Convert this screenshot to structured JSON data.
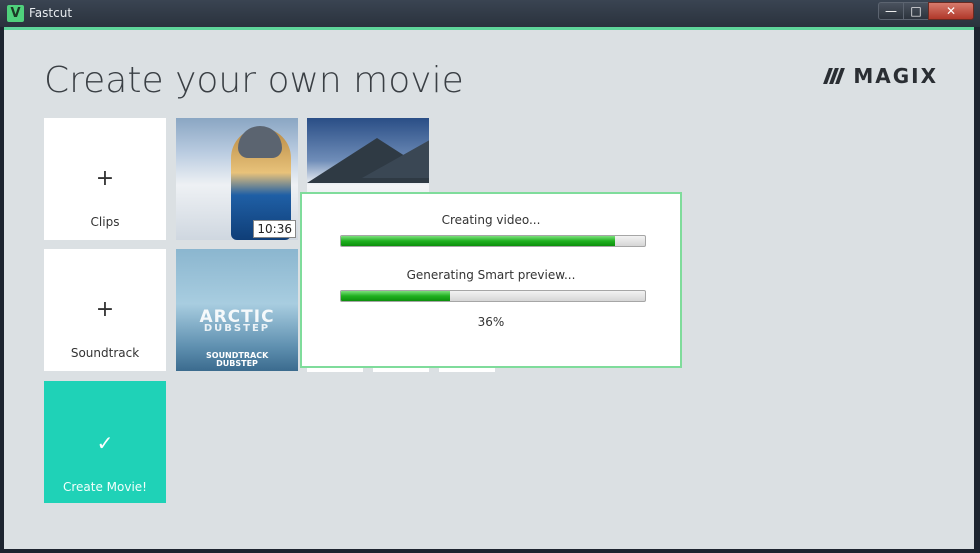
{
  "window": {
    "app_name": "Fastcut",
    "app_icon_letter": "V",
    "controls": {
      "minimize": "—",
      "maximize": "□",
      "close": "✕"
    }
  },
  "header": {
    "title": "Create your own movie",
    "brand": "MAGIX"
  },
  "tiles": {
    "clips": {
      "icon": "+",
      "label": "Clips"
    },
    "soundtrack": {
      "icon": "+",
      "label": "Soundtrack"
    },
    "create": {
      "icon": "✓",
      "label": "Create Movie!"
    }
  },
  "media": {
    "clip1_duration": "10:36",
    "soundtrack_title": "ARCTIC",
    "soundtrack_subtitle": "DUBSTEP",
    "soundtrack_badge_line1": "SOUNDTRACK",
    "soundtrack_badge_line2": "DUBSTEP"
  },
  "progress_dialog": {
    "task1_label": "Creating video...",
    "task1_progress": 0.9,
    "task2_label": "Generating Smart preview...",
    "task2_progress": 0.36,
    "task2_percent": "36%"
  },
  "colors": {
    "accent_teal": "#1fd2b7",
    "progress_green": "#20b020",
    "dialog_border": "#7fdc9b"
  }
}
